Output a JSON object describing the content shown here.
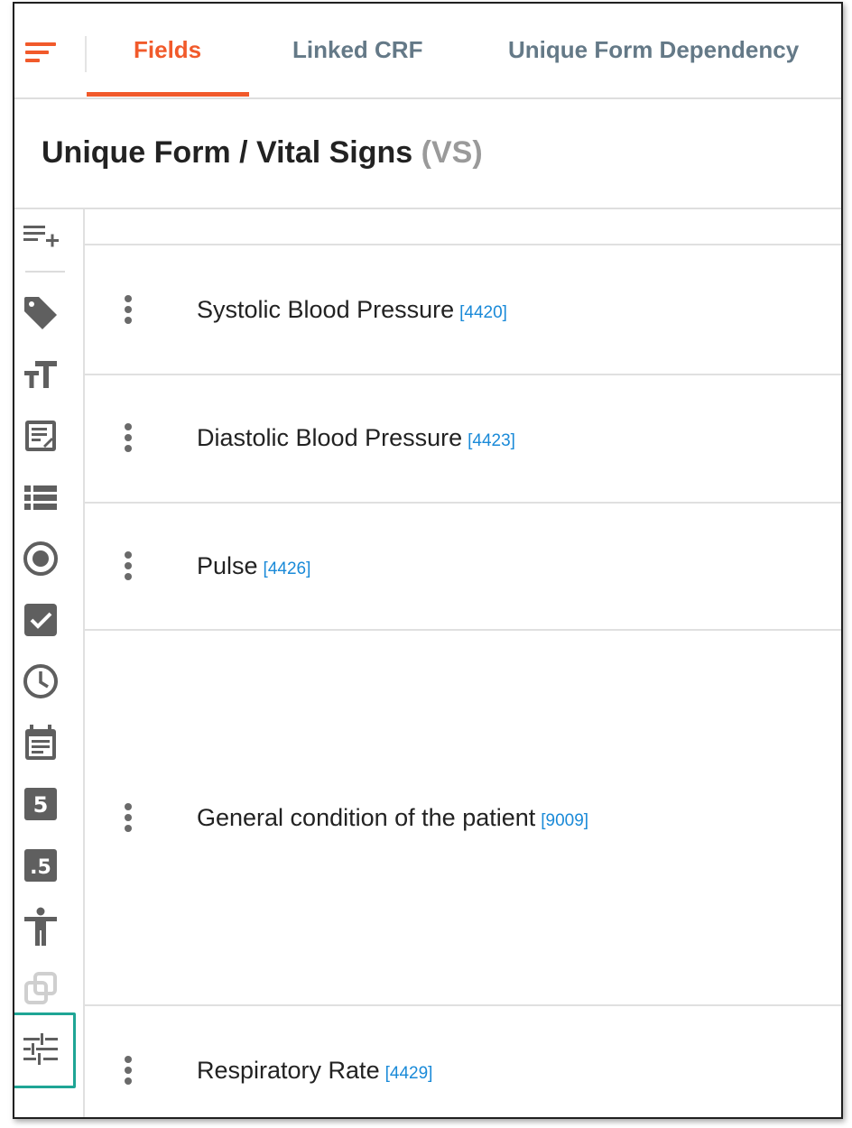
{
  "header": {
    "menu_icon": "hamburger-menu-icon",
    "tabs": [
      {
        "label": "Fields",
        "active": true
      },
      {
        "label": "Linked CRF",
        "active": false
      },
      {
        "label": "Unique Form Dependency",
        "active": false
      }
    ]
  },
  "page": {
    "title": "Unique Form / Vital Signs",
    "code": "(VS)"
  },
  "rail": {
    "icons": [
      "add-list-icon",
      "tag-icon",
      "text-size-icon",
      "text-field-icon",
      "list-icon",
      "radio-button-icon",
      "checkbox-icon",
      "clock-icon",
      "calendar-icon",
      "integer-icon",
      "decimal-icon",
      "body-figure-icon",
      "copy-icon",
      "sliders-icon"
    ],
    "integer_glyph": "5",
    "decimal_glyph": ".5"
  },
  "fields": [
    {
      "label": "Systolic Blood Pressure",
      "id": "[4420]"
    },
    {
      "label": "Diastolic Blood Pressure",
      "id": "[4423]"
    },
    {
      "label": "Pulse",
      "id": "[4426]"
    },
    {
      "label": "General condition of the patient",
      "id": "[9009]"
    },
    {
      "label": "Respiratory Rate",
      "id": "[4429]"
    }
  ],
  "colors": {
    "accent": "#f15a2b",
    "tab_inactive": "#647987",
    "id_link": "#1a8ad8",
    "selection_outline": "#1fa595",
    "icon": "#5f5f5f"
  }
}
